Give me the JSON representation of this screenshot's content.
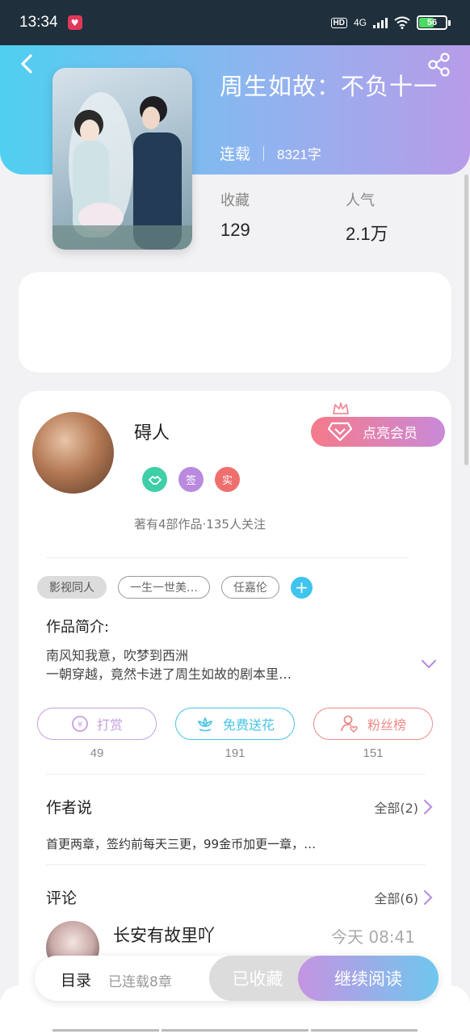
{
  "status_bar": {
    "time": "13:34",
    "network": "4G",
    "battery": "56"
  },
  "book": {
    "title": "周生如故：不负十一",
    "status": "连载",
    "word_count": "8321字",
    "stats": [
      {
        "label": "收藏",
        "value": "129"
      },
      {
        "label": "人气",
        "value": "2.1万"
      }
    ]
  },
  "author": {
    "name": "碍人",
    "badges": [
      "签",
      "实"
    ],
    "summary": "著有4部作品·135人关注",
    "vip_label": "点亮会员"
  },
  "tags": [
    "影视同人",
    "一生一世美…",
    "任嘉伦"
  ],
  "intro": {
    "title": "作品简介:",
    "line1": "南风知我意，吹梦到西洲",
    "line2": "一朝穿越，竟然卡进了周生如故的剧本里…"
  },
  "actions": [
    {
      "label": "打赏",
      "count": "49",
      "color": "#c6a0e0"
    },
    {
      "label": "免费送花",
      "count": "191",
      "color": "#46c4e6"
    },
    {
      "label": "粉丝榜",
      "count": "151",
      "color": "#ef8a8a"
    }
  ],
  "author_say": {
    "title": "作者说",
    "more": "全部(2)",
    "text": "首更两章，签约前每天三更，99金币加更一章，…"
  },
  "comments": {
    "title": "评论",
    "more": "全部(6)",
    "first": {
      "name": "长安有故里吖",
      "time": "今天 08:41"
    }
  },
  "bottom_bar": {
    "toc": "目录",
    "toc_sub": "已连载8章",
    "favorited": "已收藏",
    "continue": "继续阅读"
  }
}
